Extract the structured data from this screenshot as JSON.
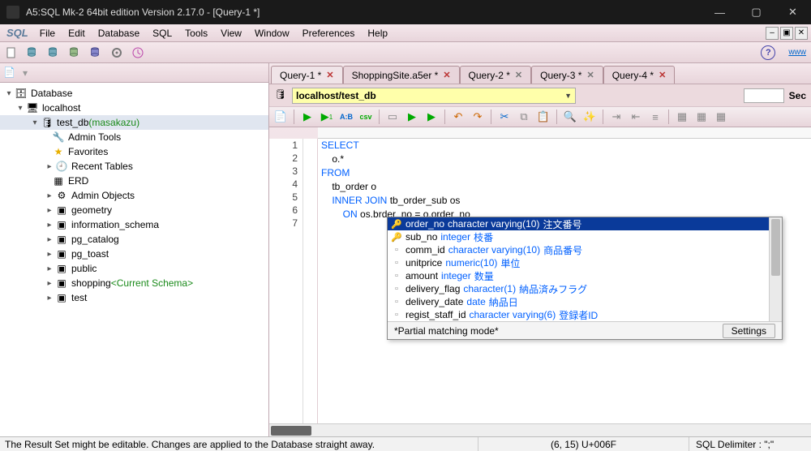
{
  "window": {
    "title": "A5:SQL Mk-2 64bit edition Version 2.17.0 - [Query-1 *]",
    "min": "—",
    "max": "▢",
    "close": "✕"
  },
  "menu": {
    "logo": "SQL",
    "items": [
      "File",
      "Edit",
      "Database",
      "SQL",
      "Tools",
      "View",
      "Window",
      "Preferences",
      "Help"
    ],
    "mini": [
      "–",
      "▣",
      "✕"
    ]
  },
  "toolbar_help": "?",
  "toolbar_www": "www",
  "tree": {
    "root": "Database",
    "server": "localhost",
    "db": "test_db",
    "db_user": "(masakazu)",
    "children": [
      "Admin Tools",
      "Favorites",
      "Recent Tables",
      "ERD",
      "Admin Objects",
      "geometry",
      "information_schema",
      "pg_catalog",
      "pg_toast",
      "public",
      "shopping",
      "test"
    ],
    "current_schema": "<Current Schema>"
  },
  "tabs": [
    {
      "label": "Query-1 *",
      "close": "red",
      "active": true
    },
    {
      "label": "ShoppingSite.a5er *",
      "close": "red"
    },
    {
      "label": "Query-2 *",
      "close": "gray"
    },
    {
      "label": "Query-3 *",
      "close": "gray"
    },
    {
      "label": "Query-4 *",
      "close": "red"
    }
  ],
  "db_selector": "localhost/test_db",
  "sec_label": "Sec",
  "editor_toolbar": {
    "abc": "A:B",
    "csv": "csv"
  },
  "code": {
    "lines": [
      "1",
      "2",
      "3",
      "4",
      "5",
      "6",
      "7"
    ],
    "l1": "SELECT",
    "l2": "    o.*",
    "l3": "FROM",
    "l4": "    tb_order o",
    "l5a": "    INNER JOIN ",
    "l5b": "tb_order_sub os",
    "l6a": "        ON ",
    "l6b": "os.brder_no = o.order_no",
    "l7": ""
  },
  "ac": {
    "items": [
      {
        "col": "order_no",
        "type": "character varying(10)",
        "desc": "注文番号",
        "sel": true
      },
      {
        "col": "sub_no",
        "type": "integer",
        "desc": "枝番"
      },
      {
        "col": "comm_id",
        "type": "character varying(10)",
        "desc": "商品番号"
      },
      {
        "col": "unitprice",
        "type": "numeric(10)",
        "desc": "単位"
      },
      {
        "col": "amount",
        "type": "integer",
        "desc": "数量"
      },
      {
        "col": "delivery_flag",
        "type": "character(1)",
        "desc": "納品済みフラグ"
      },
      {
        "col": "delivery_date",
        "type": "date",
        "desc": "納品日"
      },
      {
        "col": "regist_staff_id",
        "type": "character varying(6)",
        "desc": "登録者ID"
      }
    ],
    "footer": "*Partial matching mode*",
    "settings": "Settings"
  },
  "status": {
    "left": "The Result Set might be editable. Changes are applied to the Database straight away.",
    "mid": "(6, 15) U+006F",
    "right": "SQL Delimiter : \";\""
  }
}
